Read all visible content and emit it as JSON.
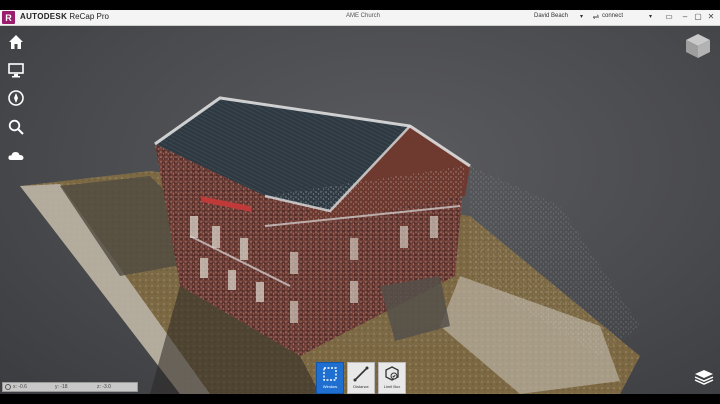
{
  "titlebar": {
    "logo_letter": "R",
    "brand": "AUTODESK",
    "product": "ReCap Pro",
    "document": "AME Church",
    "user": "David Beach",
    "connect": "connect"
  },
  "sidebar": {
    "items": [
      {
        "icon": "home-icon"
      },
      {
        "icon": "display-icon"
      },
      {
        "icon": "compass-icon"
      },
      {
        "icon": "search-icon"
      },
      {
        "icon": "cloud-icon"
      }
    ]
  },
  "tools": [
    {
      "label": "Window",
      "icon": "window-select-icon",
      "active": true
    },
    {
      "label": "Distance",
      "icon": "distance-icon",
      "active": false
    },
    {
      "label": "Limit Box",
      "icon": "limit-box-icon",
      "active": false
    }
  ],
  "coords": {
    "x": "x: -0.6",
    "y": "y: -18",
    "z": "z: -3.0"
  },
  "colors": {
    "accent": "#1f6fd1",
    "logo": "#9b1b6d",
    "titlebar": "#f4f4f4"
  }
}
